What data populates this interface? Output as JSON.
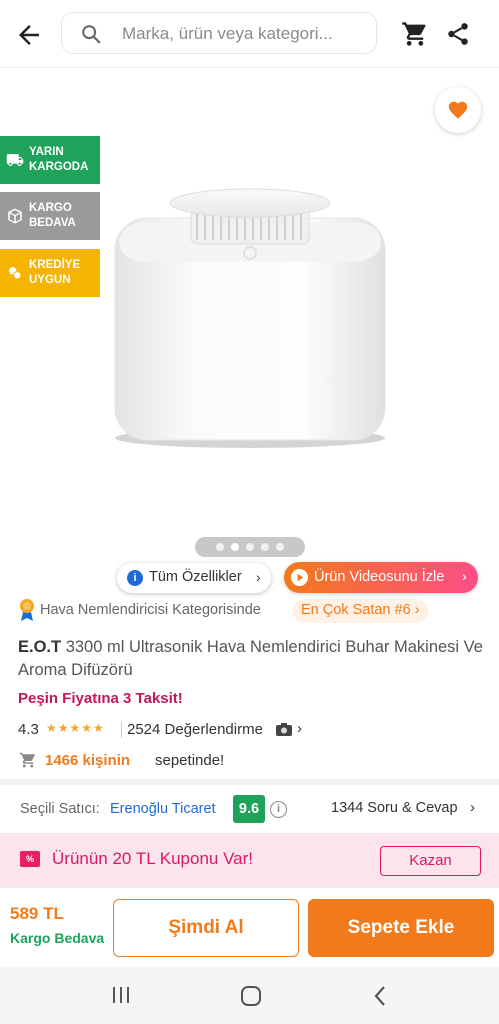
{
  "header": {
    "search_placeholder": "Marka, ürün veya kategori..."
  },
  "badges": [
    {
      "line1": "YARIN",
      "line2": "KARGODA",
      "color": "#1fa25a"
    },
    {
      "line1": "KARGO",
      "line2": "BEDAVA",
      "color": "#9a9a9a"
    },
    {
      "line1": "KREDİYE",
      "line2": "UYGUN",
      "color": "#f4b400"
    }
  ],
  "gallery": {
    "active_index": 1,
    "total_dots": 5
  },
  "actions": {
    "all_features": "Tüm Özellikler",
    "watch_video": "Ürün Videosunu İzle"
  },
  "category": {
    "text": "Hava Nemlendiricisi Kategorisinde",
    "best_seller": "En Çok Satan #6"
  },
  "product": {
    "brand": "E.O.T",
    "name": "3300 ml Ultrasonik Hava Nemlendirici Buhar Makinesi Ve Aroma Difüzörü",
    "installment": "Peşin Fiyatına 3 Taksit!",
    "rating": "4.3",
    "rating_value": 4.3,
    "review_count": "2524 Değerlendirme",
    "basket_count": "1466 kişinin",
    "basket_suffix": "sepetinde!"
  },
  "seller": {
    "label": "Seçili Satıcı:",
    "name": "Erenoğlu Ticaret",
    "score": "9.6",
    "qa": "1344 Soru & Cevap"
  },
  "coupon": {
    "text": "Ürünün 20 TL Kuponu Var!",
    "button": "Kazan",
    "icon_text": "%"
  },
  "checkout": {
    "price": "589 TL",
    "shipping": "Kargo Bedava",
    "buy_now": "Şimdi Al",
    "add_to_cart": "Sepete Ekle"
  },
  "colors": {
    "accent": "#f27a1a",
    "green": "#1fa25a",
    "coupon": "#d81b60"
  }
}
